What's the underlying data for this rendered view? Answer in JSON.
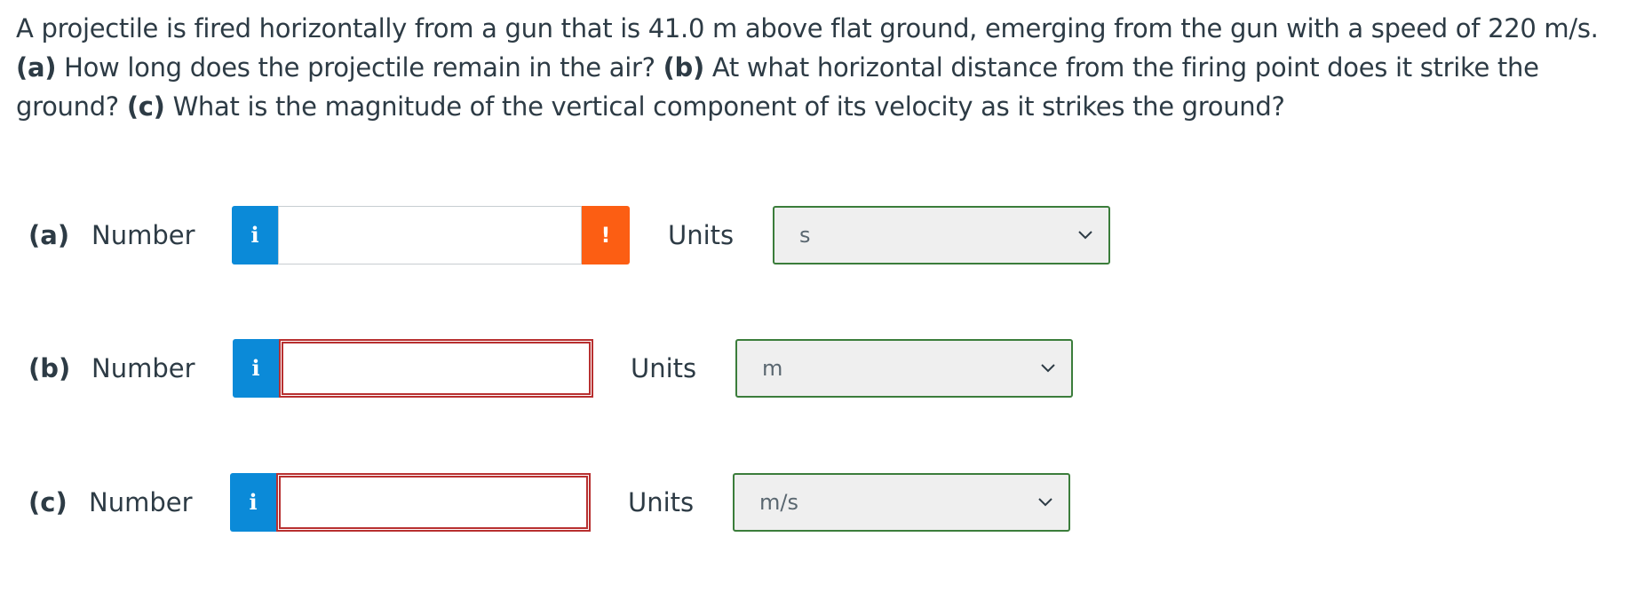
{
  "question": {
    "intro": "A projectile is fired horizontally from a gun that is 41.0 m above flat ground, emerging from the gun with a speed of 220 m/s.",
    "a_label": "(a)",
    "a_text": "How long does the projectile remain in the air?",
    "b_label": "(b)",
    "b_text": "At what horizontal distance from the firing point does it strike the ground?",
    "c_label": "(c)",
    "c_text": "What is the magnitude of the vertical component of its velocity as it strikes the ground?"
  },
  "parts": [
    {
      "label": "(a)",
      "number_label": "Number",
      "info": "i",
      "value": "",
      "warning": "!",
      "units_label": "Units",
      "units_value": "s"
    },
    {
      "label": "(b)",
      "number_label": "Number",
      "info": "i",
      "value": "",
      "units_label": "Units",
      "units_value": "m"
    },
    {
      "label": "(c)",
      "number_label": "Number",
      "info": "i",
      "value": "",
      "units_label": "Units",
      "units_value": "m/s"
    }
  ],
  "colors": {
    "info_button": "#0b8ad8",
    "warning_button": "#fc5e13",
    "invalid_border": "#b83030",
    "select_border": "#3b7d3b"
  },
  "icons": {
    "info": "info-icon",
    "warning": "warning-icon",
    "dropdown": "chevron-down-icon"
  }
}
